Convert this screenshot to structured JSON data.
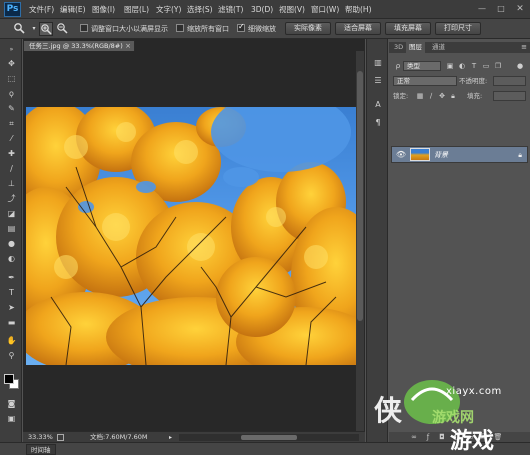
{
  "app": {
    "logo": "Ps"
  },
  "menu": [
    "文件(F)",
    "编辑(E)",
    "图像(I)",
    "图层(L)",
    "文字(Y)",
    "选择(S)",
    "滤镜(T)",
    "3D(D)",
    "视图(V)",
    "窗口(W)",
    "帮助(H)"
  ],
  "window_controls": {
    "minimize": "—",
    "maximize": "□",
    "close": "✕"
  },
  "options_bar": {
    "tool_icon": "zoom-icon",
    "zoom_in_icon": "zoom-in-icon",
    "zoom_out_icon": "zoom-out-icon",
    "resize_windows_label": "调整窗口大小以满屏显示",
    "resize_windows_checked": false,
    "zoom_all_label": "缩放所有窗口",
    "zoom_all_checked": false,
    "scrubby_zoom_label": "细微缩放",
    "scrubby_zoom_checked": true,
    "actual_pixels": "实际像素",
    "fit_screen": "适合屏幕",
    "fill_screen": "填充屏幕",
    "print_size": "打印尺寸"
  },
  "document": {
    "tab_title": "任务三.jpg @ 33.3%(RGB/8#)",
    "tab_close": "×"
  },
  "status_bar": {
    "zoom": "33.33%",
    "doc_size": "文档:7.60M/7.60M",
    "arrow": "▸"
  },
  "timeline_tab": "时间轴",
  "layers_panel": {
    "tabs": [
      "3D",
      "图层",
      "通道"
    ],
    "active_tab": 1,
    "menu": "≡",
    "collapse": "««",
    "filter_kind": "类型",
    "blend_mode": "正常",
    "opacity_label": "不透明度:",
    "lock_label": "锁定:",
    "fill_label": "填充:",
    "layer_name": "背景",
    "layer_lock": "🔒"
  },
  "watermark": {
    "text": "xiayx.com"
  },
  "colors": {
    "foreground": "#000000",
    "background": "#ffffff",
    "ui_dark": "#3c3c3c",
    "ui_mid": "#535353",
    "sky": "#4f96e6",
    "foliage": "#e8a01c"
  }
}
